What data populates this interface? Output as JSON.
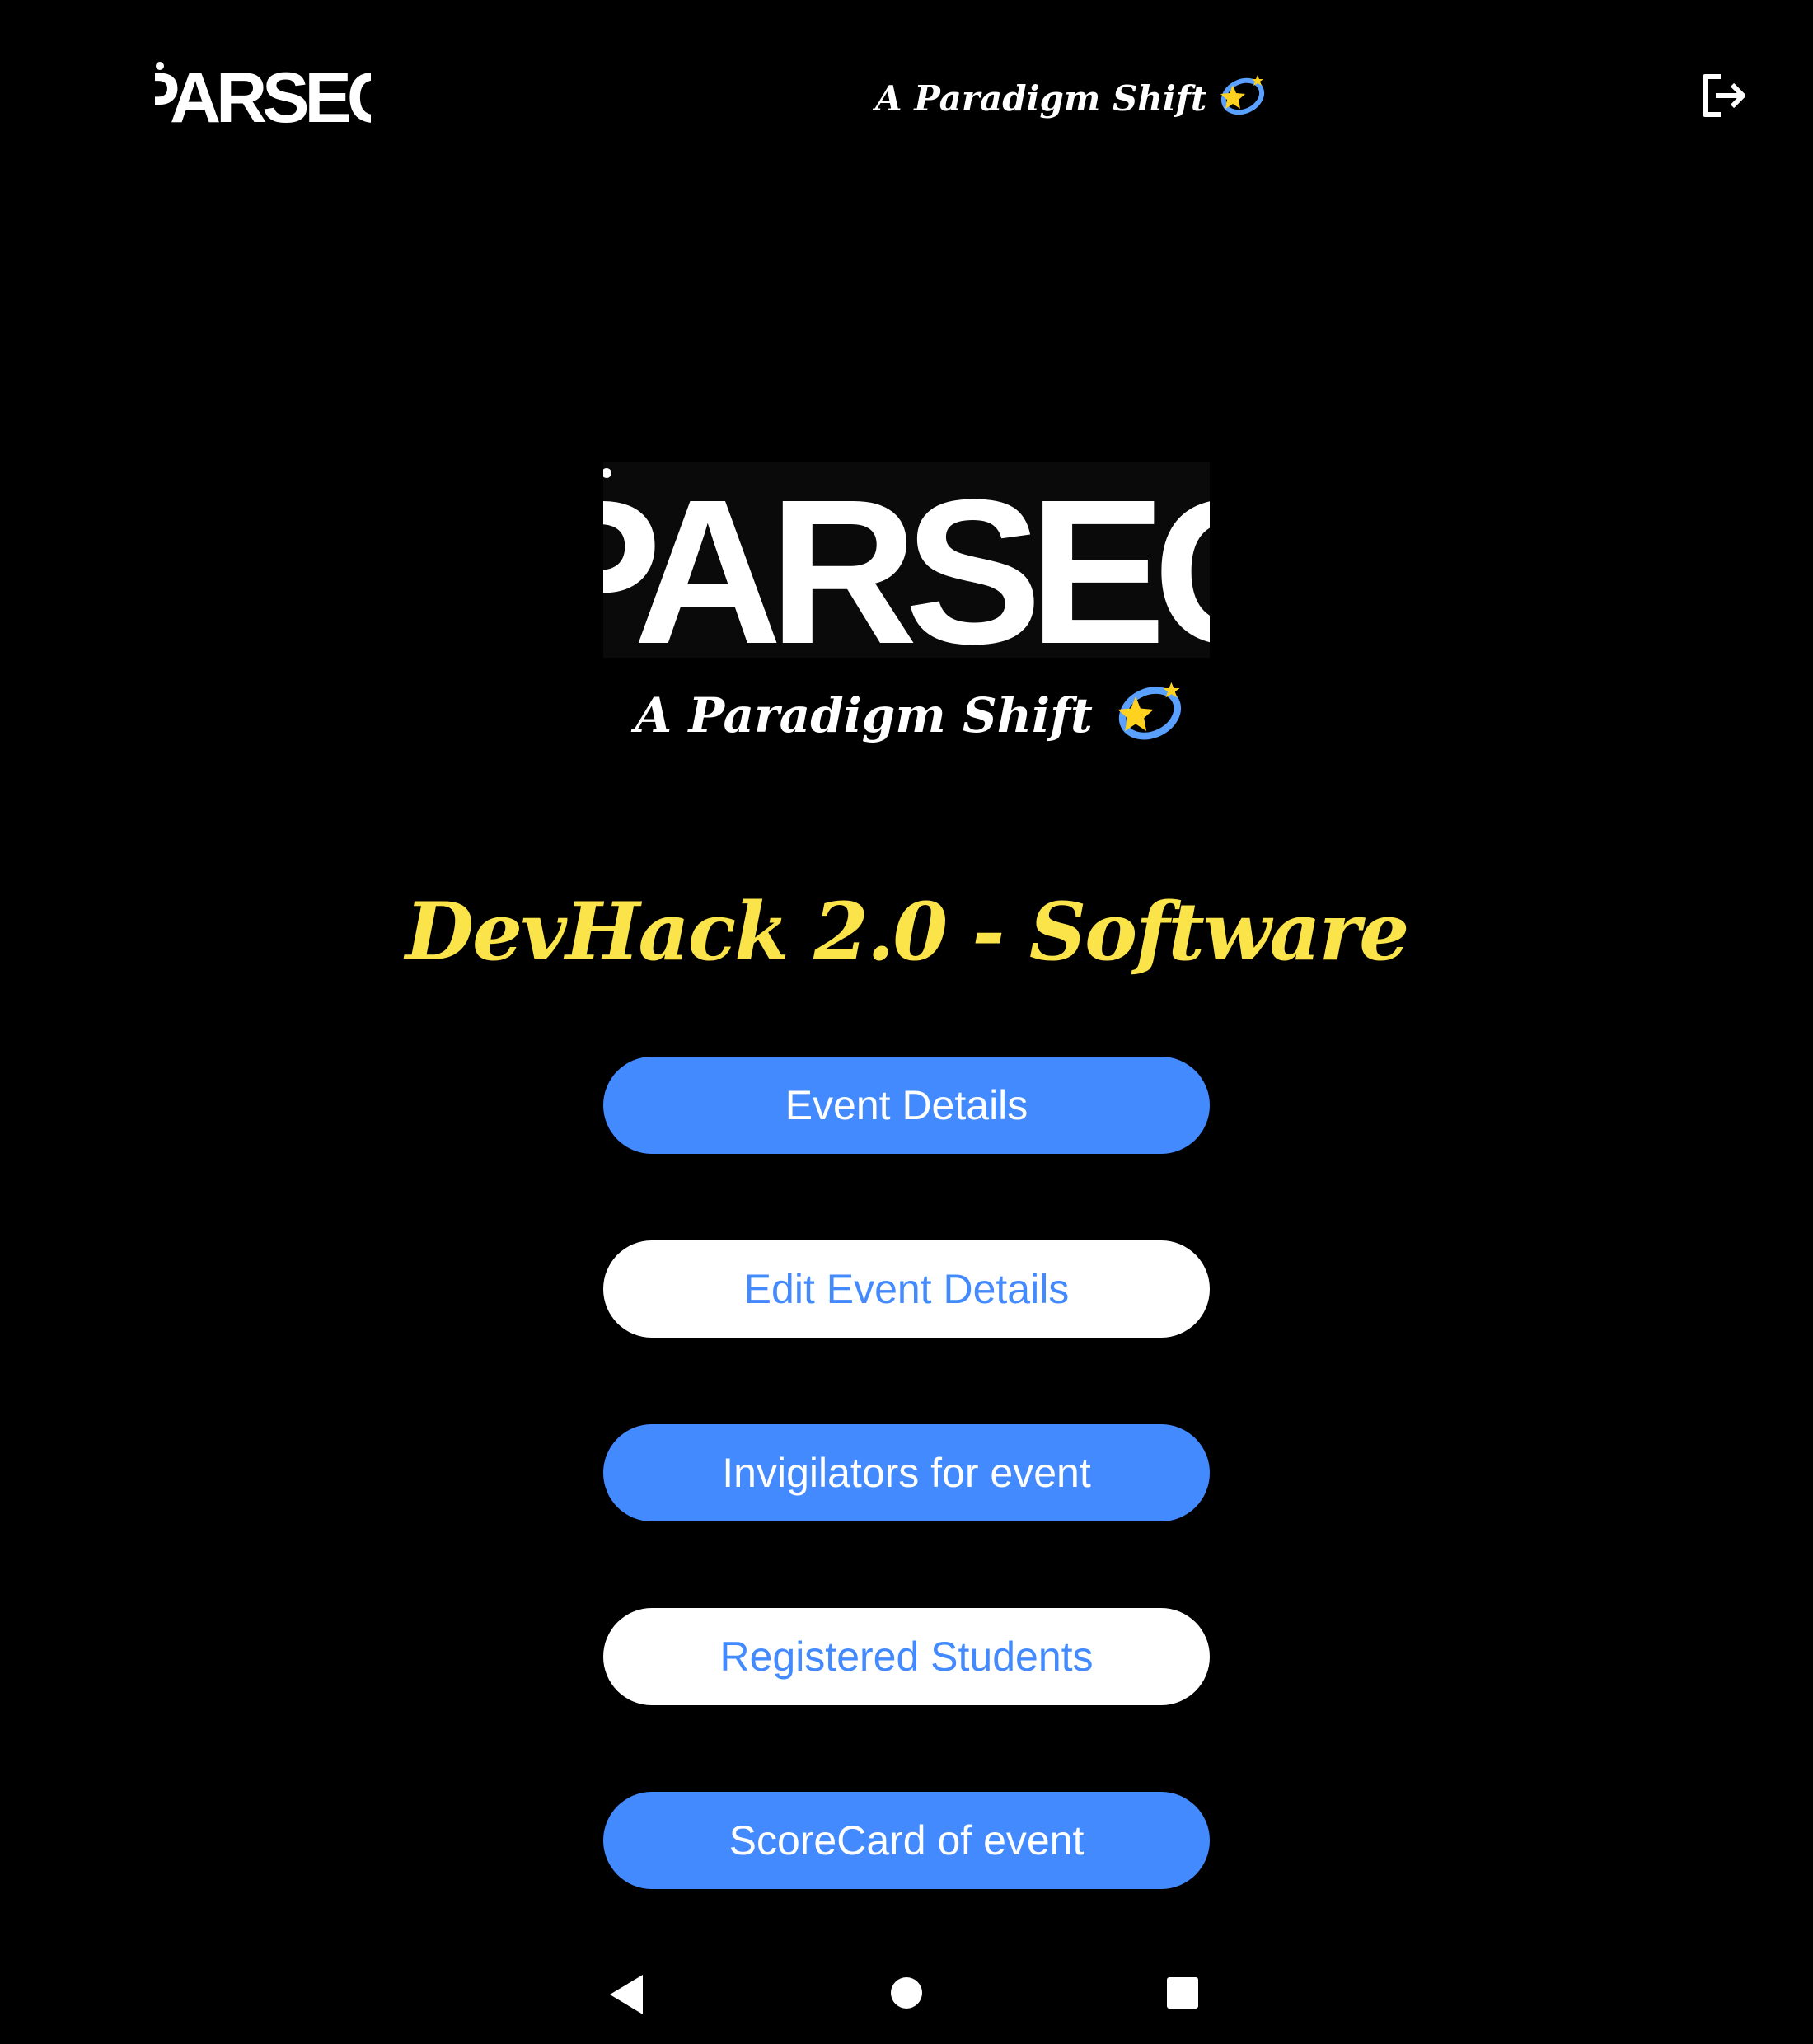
{
  "appbar": {
    "logo_text": "PARSEC",
    "tagline": "A Paradigm Shift",
    "logout_icon": "logout-icon"
  },
  "hero": {
    "logo_text": "PARSEC",
    "tagline": "A Paradigm Shift",
    "sparkle_icon": "dizzy-star-icon"
  },
  "event": {
    "title": "DevHack 2.0 - Software"
  },
  "actions": [
    {
      "label": "Event Details",
      "style": "filled"
    },
    {
      "label": "Edit Event Details",
      "style": "outline"
    },
    {
      "label": "Invigilators for event",
      "style": "filled"
    },
    {
      "label": "Registered Students",
      "style": "outline"
    },
    {
      "label": "ScoreCard of event",
      "style": "filled"
    }
  ],
  "navbar": {
    "back_icon": "back-triangle-icon",
    "home_icon": "home-circle-icon",
    "recents_icon": "recents-square-icon"
  },
  "colors": {
    "background": "#000000",
    "primary": "#448aff",
    "title": "#fbe34a",
    "text": "#ffffff"
  }
}
